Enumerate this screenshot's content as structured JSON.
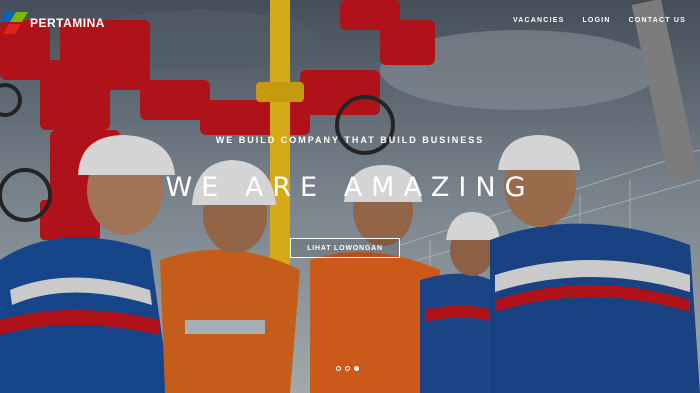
{
  "brand": {
    "name": "PERTAMINA",
    "colors": {
      "red": "#e2231a",
      "blue": "#0066b3",
      "green": "#7ab800"
    }
  },
  "nav": {
    "items": [
      {
        "label": "VACANCIES"
      },
      {
        "label": "LOGIN"
      },
      {
        "label": "CONTACT US"
      }
    ]
  },
  "hero": {
    "tagline": "WE BUILD COMPANY THAT BUILD BUSINESS",
    "headline": "WE ARE AMAZING",
    "cta_label": "LIHAT LOWONGAN",
    "slides_total": 3,
    "active_slide": 3
  }
}
